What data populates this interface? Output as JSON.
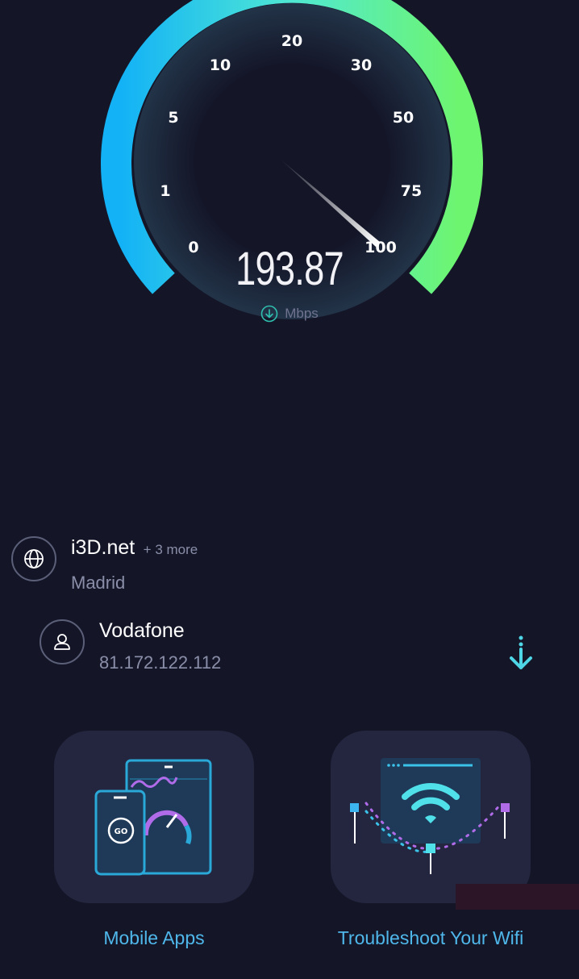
{
  "gauge": {
    "ticks": [
      "0",
      "1",
      "5",
      "10",
      "20",
      "30",
      "50",
      "75",
      "100"
    ],
    "colors": {
      "start": "#15b6f4",
      "end": "#6ef56f"
    }
  },
  "result": {
    "speed": "193.87",
    "unit": "Mbps"
  },
  "server": {
    "name": "i3D.net",
    "more": "+ 3 more",
    "location": "Madrid"
  },
  "provider": {
    "name": "Vodafone",
    "ip": "81.172.122.112"
  },
  "tiles": [
    {
      "label": "Mobile Apps",
      "go_text": "GO"
    },
    {
      "label": "Troubleshoot Your Wifi"
    }
  ]
}
